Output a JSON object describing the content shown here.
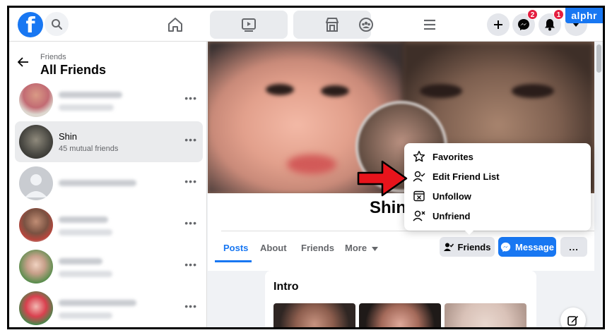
{
  "watermark": "alphr",
  "topbar": {
    "logo": "f",
    "messenger_badge": "2",
    "notifications_badge": "1"
  },
  "sidebar": {
    "breadcrumb": "Friends",
    "title": "All Friends",
    "selected_friend": {
      "name": "Shin",
      "mutual": "45 mutual friends"
    }
  },
  "profile": {
    "name": "Shin",
    "tabs": [
      "Posts",
      "About",
      "Friends",
      "More"
    ],
    "active_tab": "Posts",
    "friends_button": "Friends",
    "message_button": "Message",
    "more_button": "..."
  },
  "friend_menu": {
    "items": [
      "Favorites",
      "Edit Friend List",
      "Unfollow",
      "Unfriend"
    ]
  },
  "intro": {
    "title": "Intro"
  },
  "icons": {
    "logo": "facebook-logo-icon",
    "search": "search-icon",
    "home": "home-icon",
    "watch": "video-icon",
    "marketplace": "store-icon",
    "groups": "groups-icon",
    "menu": "hamburger-icon",
    "create": "plus-icon",
    "messenger": "messenger-icon",
    "notifications": "bell-icon",
    "account": "caret-down-icon",
    "compose": "compose-icon"
  },
  "colors": {
    "accent": "#1877f2",
    "badge": "#e41e3f",
    "arrow": "#e8141c"
  }
}
